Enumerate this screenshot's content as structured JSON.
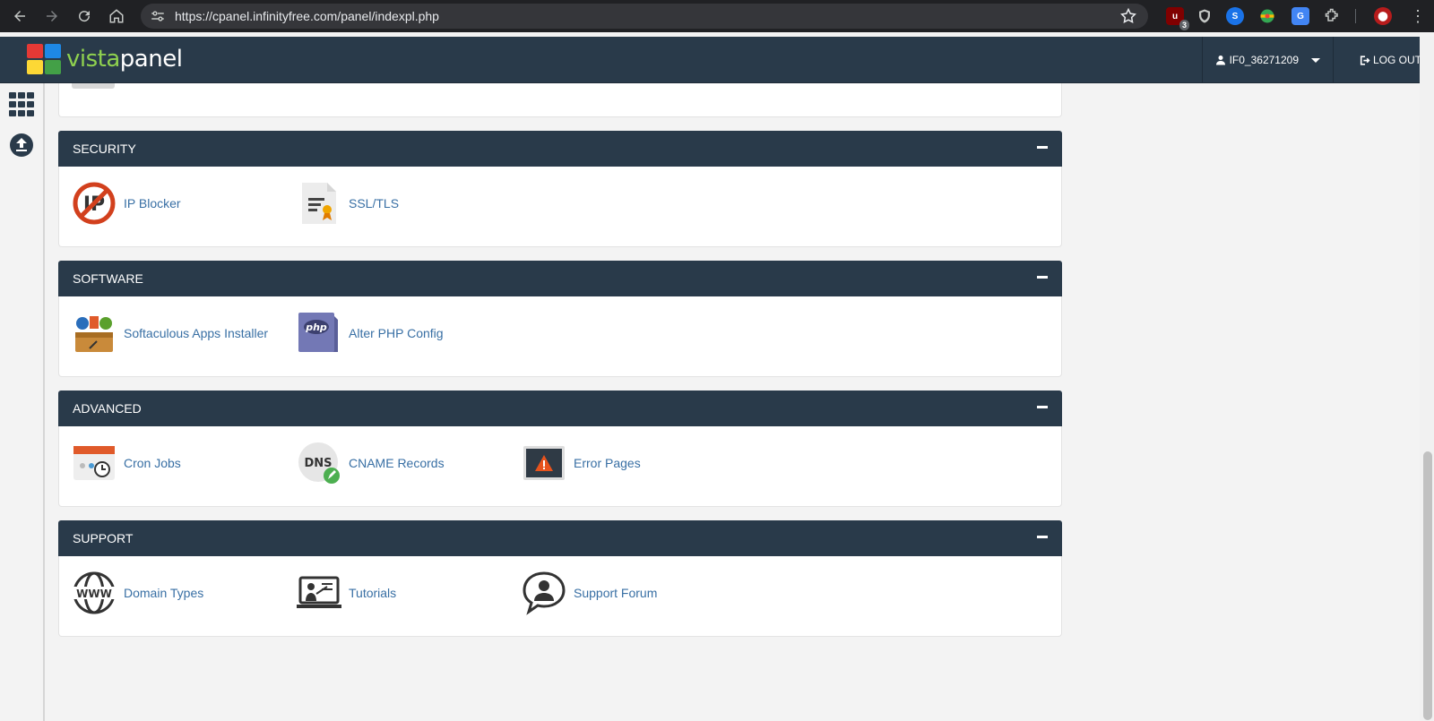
{
  "browser": {
    "url": "https://cpanel.infinityfree.com/panel/indexpl.php",
    "extension_badge": "3"
  },
  "header": {
    "logo_part1": "vista",
    "logo_part2": "panel",
    "username": "IF0_36271209",
    "logout_label": "LOG OUT"
  },
  "sections": [
    {
      "title": "SECURITY",
      "items": [
        {
          "label": "IP Blocker",
          "icon": "ip-blocker-icon"
        },
        {
          "label": "SSL/TLS",
          "icon": "ssl-certificate-icon"
        }
      ]
    },
    {
      "title": "SOFTWARE",
      "items": [
        {
          "label": "Softaculous Apps Installer",
          "icon": "softaculous-icon"
        },
        {
          "label": "Alter PHP Config",
          "icon": "php-config-icon"
        }
      ]
    },
    {
      "title": "ADVANCED",
      "items": [
        {
          "label": "Cron Jobs",
          "icon": "cron-calendar-icon"
        },
        {
          "label": "CNAME Records",
          "icon": "dns-icon"
        },
        {
          "label": "Error Pages",
          "icon": "error-warning-icon"
        }
      ]
    },
    {
      "title": "SUPPORT",
      "items": [
        {
          "label": "Domain Types",
          "icon": "www-globe-icon"
        },
        {
          "label": "Tutorials",
          "icon": "tutorials-presentation-icon"
        },
        {
          "label": "Support Forum",
          "icon": "chat-bubble-user-icon"
        }
      ]
    }
  ],
  "colors": {
    "header_bg": "#293a4a",
    "link": "#386fa4",
    "page_bg": "#f3f3f3"
  }
}
